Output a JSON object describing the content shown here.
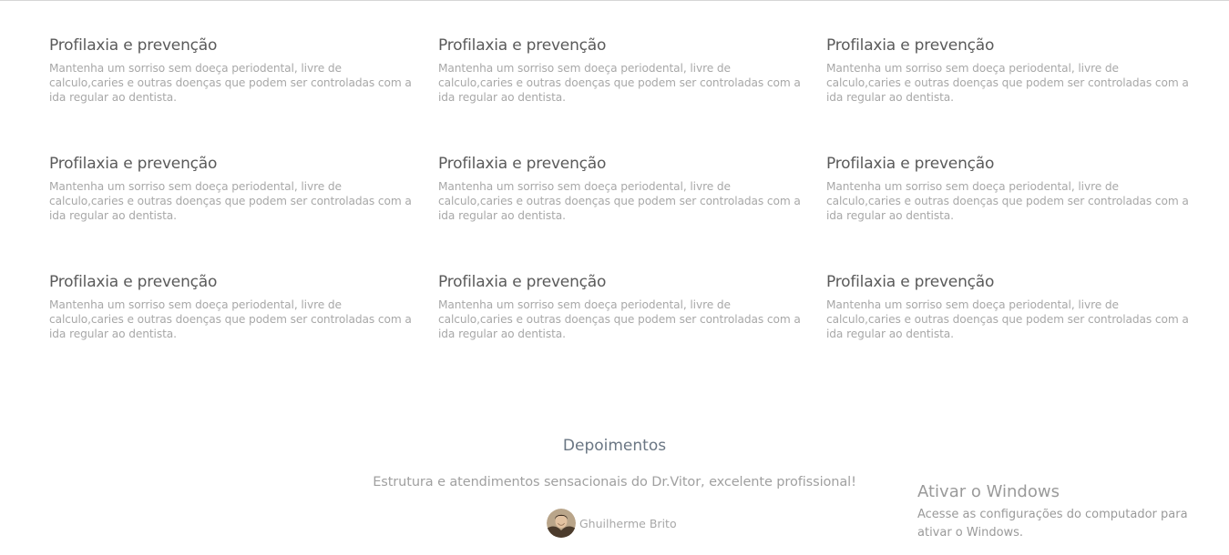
{
  "services": [
    {
      "title": "Profilaxia e prevenção",
      "description": "Mantenha um sorriso sem doeça periodental, livre de calculo,caries e outras doenças que podem ser controladas com a ida regular ao dentista."
    },
    {
      "title": "Profilaxia e prevenção",
      "description": "Mantenha um sorriso sem doeça periodental, livre de calculo,caries e outras doenças que podem ser controladas com a ida regular ao dentista."
    },
    {
      "title": "Profilaxia e prevenção",
      "description": "Mantenha um sorriso sem doeça periodental, livre de calculo,caries e outras doenças que podem ser controladas com a ida regular ao dentista."
    },
    {
      "title": "Profilaxia e prevenção",
      "description": "Mantenha um sorriso sem doeça periodental, livre de calculo,caries e outras doenças que podem ser controladas com a ida regular ao dentista."
    },
    {
      "title": "Profilaxia e prevenção",
      "description": "Mantenha um sorriso sem doeça periodental, livre de calculo,caries e outras doenças que podem ser controladas com a ida regular ao dentista."
    },
    {
      "title": "Profilaxia e prevenção",
      "description": "Mantenha um sorriso sem doeça periodental, livre de calculo,caries e outras doenças que podem ser controladas com a ida regular ao dentista."
    },
    {
      "title": "Profilaxia e prevenção",
      "description": "Mantenha um sorriso sem doeça periodental, livre de calculo,caries e outras doenças que podem ser controladas com a ida regular ao dentista."
    },
    {
      "title": "Profilaxia e prevenção",
      "description": "Mantenha um sorriso sem doeça periodental, livre de calculo,caries e outras doenças que podem ser controladas com a ida regular ao dentista."
    },
    {
      "title": "Profilaxia e prevenção",
      "description": "Mantenha um sorriso sem doeça periodental, livre de calculo,caries e outras doenças que podem ser controladas com a ida regular ao dentista."
    }
  ],
  "testimonials": {
    "title": "Depoimentos",
    "quote": "Estrutura e atendimentos sensacionais do Dr.Vitor, excelente profissional!",
    "author": "Ghuilherme Brito"
  },
  "windows_watermark": {
    "title": "Ativar o Windows",
    "text": "Acesse as configurações do computador para ativar o Windows."
  },
  "colors": {
    "service_title": "#5a5a5a",
    "service_text": "#a8a8a8",
    "section_title": "#6a7683",
    "quote_text": "#a0a0a0",
    "watermark": "#9a9a9a"
  },
  "icons": {
    "author_avatar": "avatar-photo"
  }
}
